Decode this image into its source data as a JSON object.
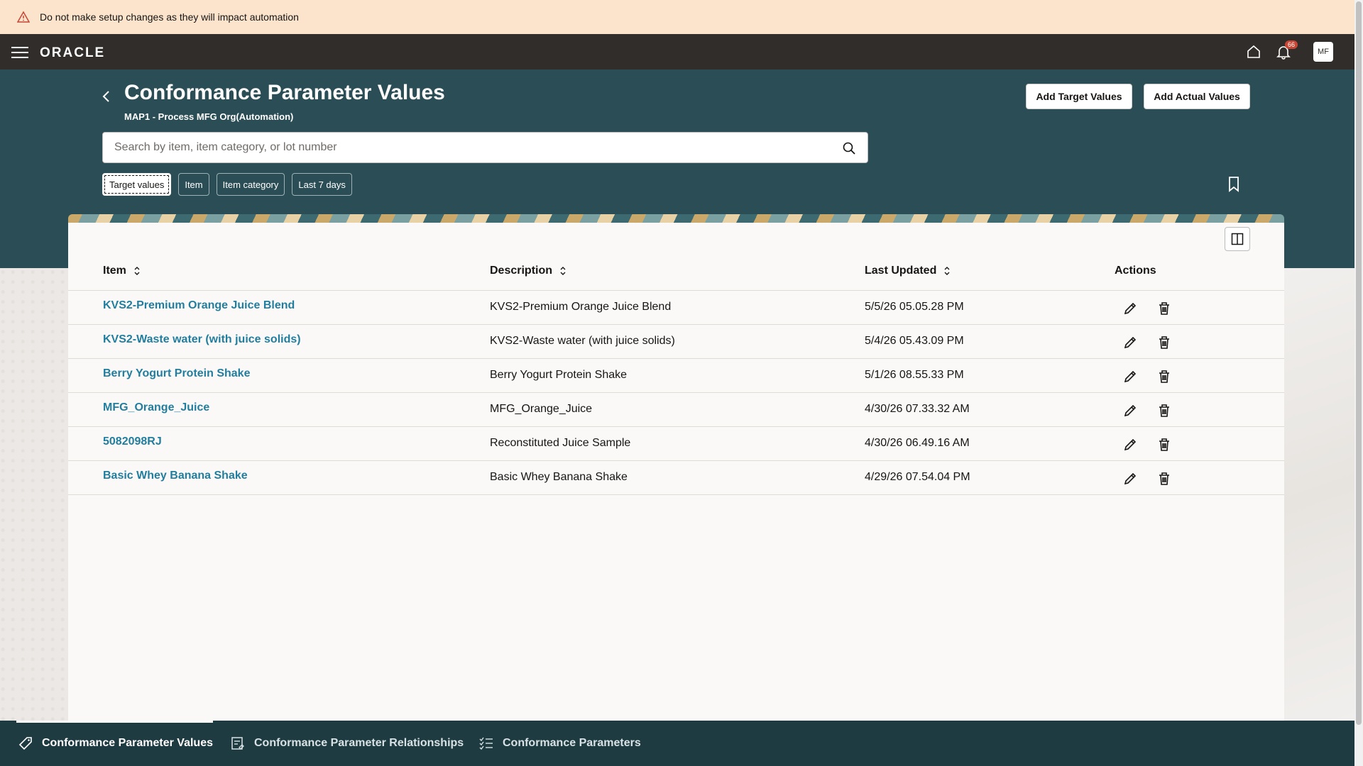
{
  "banner": {
    "message": "Do not make setup changes as they will impact automation"
  },
  "topbar": {
    "logo": "ORACLE",
    "notification_count": "66",
    "avatar_initials": "MF"
  },
  "header": {
    "title": "Conformance Parameter Values",
    "subtitle": "MAP1 - Process MFG Org(Automation)",
    "add_target_label": "Add Target Values",
    "add_actual_label": "Add Actual Values"
  },
  "search": {
    "placeholder": "Search by item, item category, or lot number",
    "value": ""
  },
  "filters": [
    {
      "label": "Target values",
      "selected": true
    },
    {
      "label": "Item",
      "selected": false
    },
    {
      "label": "Item category",
      "selected": false
    },
    {
      "label": "Last 7 days",
      "selected": false
    }
  ],
  "table": {
    "columns": [
      "Item",
      "Description",
      "Last Updated",
      "Actions"
    ],
    "rows": [
      {
        "item": "KVS2-Premium Orange Juice Blend",
        "description": "KVS2-Premium Orange Juice Blend",
        "updated": "5/5/26 05.05.28 PM"
      },
      {
        "item": "KVS2-Waste water (with juice solids)",
        "description": "KVS2-Waste water (with juice solids)",
        "updated": "5/4/26 05.43.09 PM"
      },
      {
        "item": "Berry Yogurt Protein Shake",
        "description": "Berry Yogurt Protein Shake",
        "updated": "5/1/26 08.55.33 PM"
      },
      {
        "item": "MFG_Orange_Juice",
        "description": "MFG_Orange_Juice",
        "updated": "4/30/26 07.33.32 AM"
      },
      {
        "item": "5082098RJ",
        "description": "Reconstituted Juice Sample",
        "updated": "4/30/26 06.49.16 AM"
      },
      {
        "item": "Basic Whey Banana Shake",
        "description": "Basic Whey Banana Shake",
        "updated": "4/29/26 07.54.04 PM"
      }
    ]
  },
  "bottom_nav": [
    {
      "label": "Conformance Parameter Values",
      "icon": "tag-icon",
      "active": true
    },
    {
      "label": "Conformance Parameter Relationships",
      "icon": "relationship-icon",
      "active": false
    },
    {
      "label": "Conformance Parameters",
      "icon": "checklist-icon",
      "active": false
    }
  ],
  "colors": {
    "hero": "#2b4d55",
    "topbar": "#312d2a",
    "banner": "#fbe3cc",
    "link": "#227e9e",
    "bottom_bar": "#1f3b42"
  }
}
